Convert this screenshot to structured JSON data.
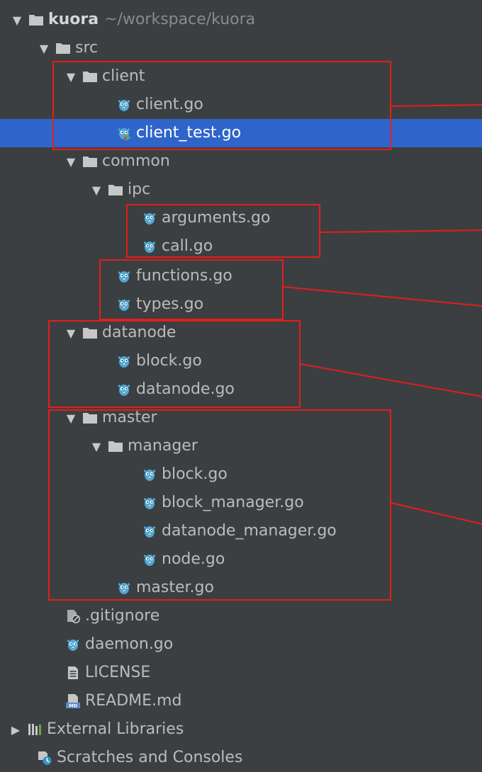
{
  "project": {
    "name": "kuora",
    "path": "~/workspace/kuora"
  },
  "folders": {
    "src": "src",
    "client": "client",
    "common": "common",
    "ipc": "ipc",
    "datanode": "datanode",
    "master": "master",
    "manager": "manager"
  },
  "files": {
    "client_go": "client.go",
    "client_test_go": "client_test.go",
    "arguments_go": "arguments.go",
    "call_go": "call.go",
    "functions_go": "functions.go",
    "types_go": "types.go",
    "block_go_datanode": "block.go",
    "datanode_go": "datanode.go",
    "block_go_manager": "block.go",
    "block_manager_go": "block_manager.go",
    "datanode_manager_go": "datanode_manager.go",
    "node_go": "node.go",
    "master_go": "master.go",
    "gitignore": ".gitignore",
    "daemon_go": "daemon.go",
    "license": "LICENSE",
    "readme": "README.md"
  },
  "external_libraries": "External Libraries",
  "scratches": "Scratches and Consoles",
  "selected_item": "client_test.go",
  "colors": {
    "panel_bg": "#3c3f41",
    "selection": "#2f65ca",
    "annotation": "#e41d1d",
    "folder": "#c7c7c7",
    "go_file": "#4aa9d8"
  },
  "icons": {
    "folder": "folder-icon",
    "go_file": "go-file-icon",
    "text_file": "text-file-icon",
    "ignore_file": "ignore-file-icon",
    "markdown_file": "markdown-file-icon",
    "libraries": "libraries-icon",
    "scratches": "scratches-icon",
    "expanded": "expanded-arrow-icon",
    "collapsed": "collapsed-arrow-icon"
  }
}
